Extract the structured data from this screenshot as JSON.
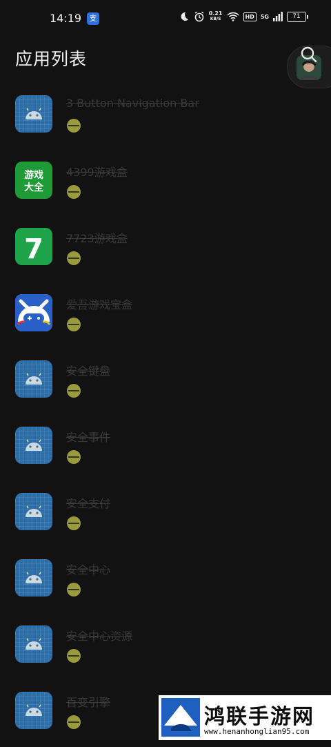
{
  "status_bar": {
    "time": "14:19",
    "app_badge": "支",
    "net_speed_value": "0.21",
    "net_speed_unit": "KB/S",
    "hd_label": "HD",
    "network_label": "5G",
    "battery_level": "71"
  },
  "header": {
    "title": "应用列表"
  },
  "apps": [
    {
      "name": "3 Button Navigation Bar",
      "icon": "android-icon"
    },
    {
      "name": "4399游戏盒",
      "icon": "4399-icon",
      "icon_text": [
        "游戏",
        "大全"
      ]
    },
    {
      "name": "7723游戏盒",
      "icon": "7723-icon",
      "icon_text": "7"
    },
    {
      "name": "爱吾游戏宝盒",
      "icon": "aiwu-icon"
    },
    {
      "name": "安全键盘",
      "icon": "android-icon"
    },
    {
      "name": "安全事件",
      "icon": "android-icon"
    },
    {
      "name": "安全支付",
      "icon": "android-icon"
    },
    {
      "name": "安全中心",
      "icon": "android-icon"
    },
    {
      "name": "安全中心资源",
      "icon": "android-icon"
    },
    {
      "name": "百变引擎",
      "icon": "android-icon"
    }
  ],
  "watermark": {
    "name": "鸿联手游网",
    "url": "www.henanhonglian95.com"
  },
  "colors": {
    "background": "#121212",
    "android_icon": "#2d6ea8",
    "status_dot": "#9b9b3c",
    "disabled_text": "#3a3a3a"
  }
}
